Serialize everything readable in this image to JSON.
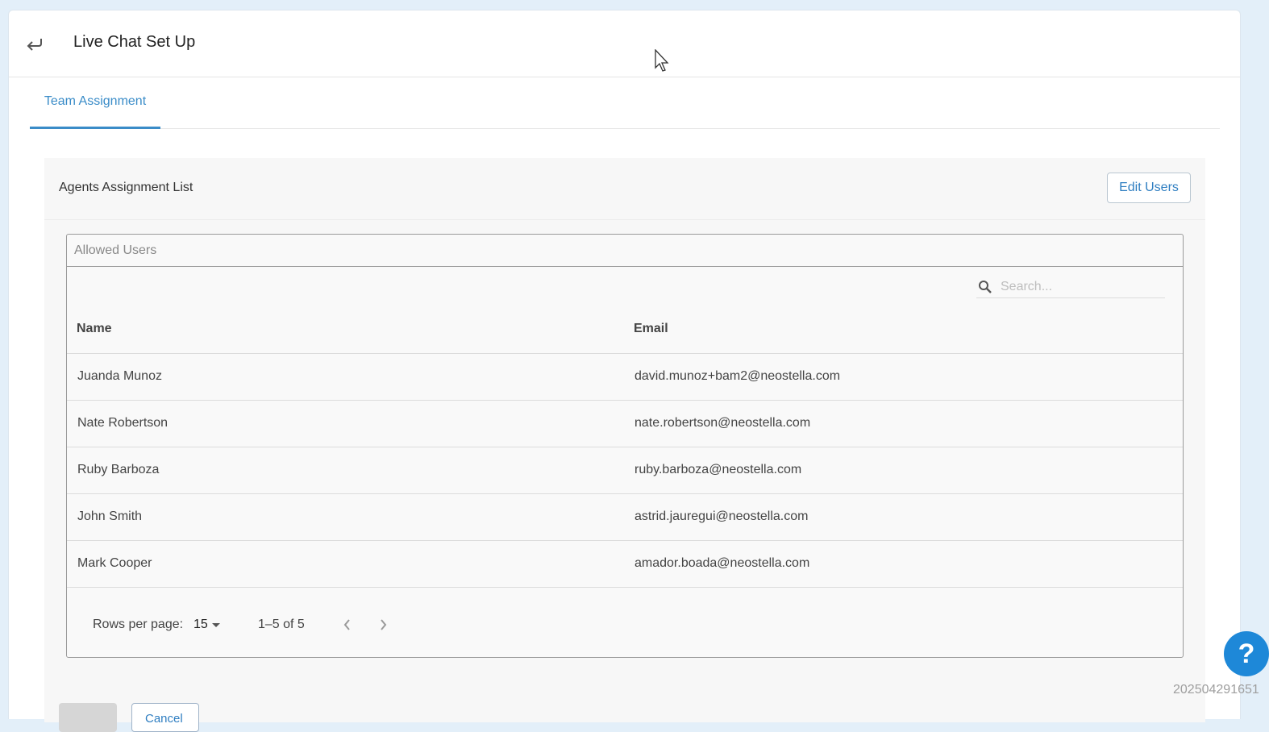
{
  "header": {
    "title": "Live Chat Set Up",
    "back_icon": "return-arrow-icon"
  },
  "tabs": [
    {
      "label": "Team Assignment",
      "active": true
    }
  ],
  "card": {
    "title": "Agents Assignment List",
    "edit_button": "Edit Users",
    "box_title": "Allowed Users",
    "search": {
      "placeholder": "Search..."
    },
    "columns": {
      "name": "Name",
      "email": "Email"
    },
    "rows": [
      {
        "name": "Juanda Munoz",
        "email": "david.munoz+bam2@neostella.com"
      },
      {
        "name": "Nate Robertson",
        "email": "nate.robertson@neostella.com"
      },
      {
        "name": "Ruby Barboza",
        "email": "ruby.barboza@neostella.com"
      },
      {
        "name": "John Smith",
        "email": "astrid.jauregui@neostella.com"
      },
      {
        "name": "Mark Cooper",
        "email": "amador.boada@neostella.com"
      }
    ],
    "pagination": {
      "rows_per_page_label": "Rows per page:",
      "rows_per_page": "15",
      "range": "1–5 of 5"
    },
    "footer": {
      "cancel_label": "Cancel"
    }
  },
  "help": {
    "label": "?"
  },
  "build_id": "202504291651",
  "colors": {
    "accent": "#3a8cc8",
    "help": "#1e88d8",
    "background": "#e3eff9"
  }
}
